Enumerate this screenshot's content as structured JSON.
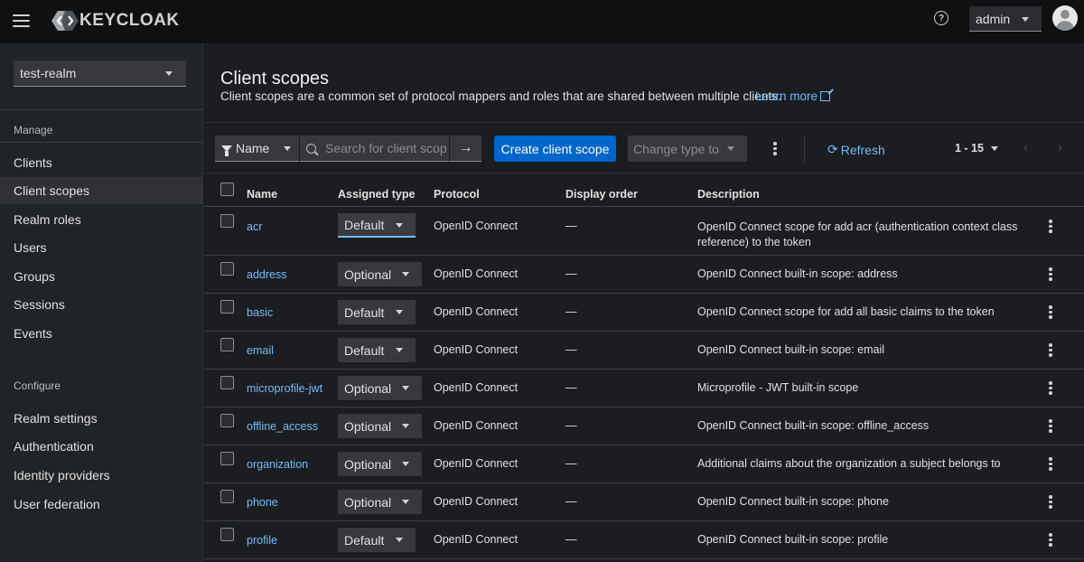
{
  "header": {
    "logo_text": "KEYCLOAK",
    "help_icon": "question-circle-icon",
    "user": "admin"
  },
  "sidebar": {
    "realm": "test-realm",
    "manage_label": "Manage",
    "manage_items": [
      {
        "label": "Clients",
        "active": false
      },
      {
        "label": "Client scopes",
        "active": true
      },
      {
        "label": "Realm roles",
        "active": false
      },
      {
        "label": "Users",
        "active": false
      },
      {
        "label": "Groups",
        "active": false
      },
      {
        "label": "Sessions",
        "active": false
      },
      {
        "label": "Events",
        "active": false
      }
    ],
    "configure_label": "Configure",
    "configure_items": [
      {
        "label": "Realm settings"
      },
      {
        "label": "Authentication"
      },
      {
        "label": "Identity providers"
      },
      {
        "label": "User federation"
      }
    ]
  },
  "page": {
    "title": "Client scopes",
    "description": "Client scopes are a common set of protocol mappers and roles that are shared between multiple clients.",
    "learn_more": "Learn more"
  },
  "toolbar": {
    "filter_label": "Name",
    "search_placeholder": "Search for client scope",
    "create_label": "Create client scope",
    "change_type_label": "Change type to",
    "refresh_label": "Refresh",
    "pagination": "1 - 15"
  },
  "table": {
    "columns": [
      "Name",
      "Assigned type",
      "Protocol",
      "Display order",
      "Description"
    ],
    "rows": [
      {
        "name": "acr",
        "type": "Default",
        "protocol": "OpenID Connect",
        "order": "—",
        "desc_line1": "OpenID Connect scope for add acr (authentication context class",
        "desc_line2": "reference) to the token"
      },
      {
        "name": "address",
        "type": "Optional",
        "protocol": "OpenID Connect",
        "order": "—",
        "desc_line1": "OpenID Connect built-in scope: address",
        "desc_line2": ""
      },
      {
        "name": "basic",
        "type": "Default",
        "protocol": "OpenID Connect",
        "order": "—",
        "desc_line1": "OpenID Connect scope for add all basic claims to the token",
        "desc_line2": ""
      },
      {
        "name": "email",
        "type": "Default",
        "protocol": "OpenID Connect",
        "order": "—",
        "desc_line1": "OpenID Connect built-in scope: email",
        "desc_line2": ""
      },
      {
        "name": "microprofile-jwt",
        "type": "Optional",
        "protocol": "OpenID Connect",
        "order": "—",
        "desc_line1": "Microprofile - JWT built-in scope",
        "desc_line2": ""
      },
      {
        "name": "offline_access",
        "type": "Optional",
        "protocol": "OpenID Connect",
        "order": "—",
        "desc_line1": "OpenID Connect built-in scope: offline_access",
        "desc_line2": ""
      },
      {
        "name": "organization",
        "type": "Optional",
        "protocol": "OpenID Connect",
        "order": "—",
        "desc_line1": "Additional claims about the organization a subject belongs to",
        "desc_line2": ""
      },
      {
        "name": "phone",
        "type": "Optional",
        "protocol": "OpenID Connect",
        "order": "—",
        "desc_line1": "OpenID Connect built-in scope: phone",
        "desc_line2": ""
      },
      {
        "name": "profile",
        "type": "Default",
        "protocol": "OpenID Connect",
        "order": "—",
        "desc_line1": "OpenID Connect built-in scope: profile",
        "desc_line2": ""
      }
    ]
  },
  "colors": {
    "accent": "#0066cc",
    "link": "#73bcf7",
    "masthead": "#0f1012",
    "sidebar": "#212427",
    "main": "#1b1d21"
  }
}
